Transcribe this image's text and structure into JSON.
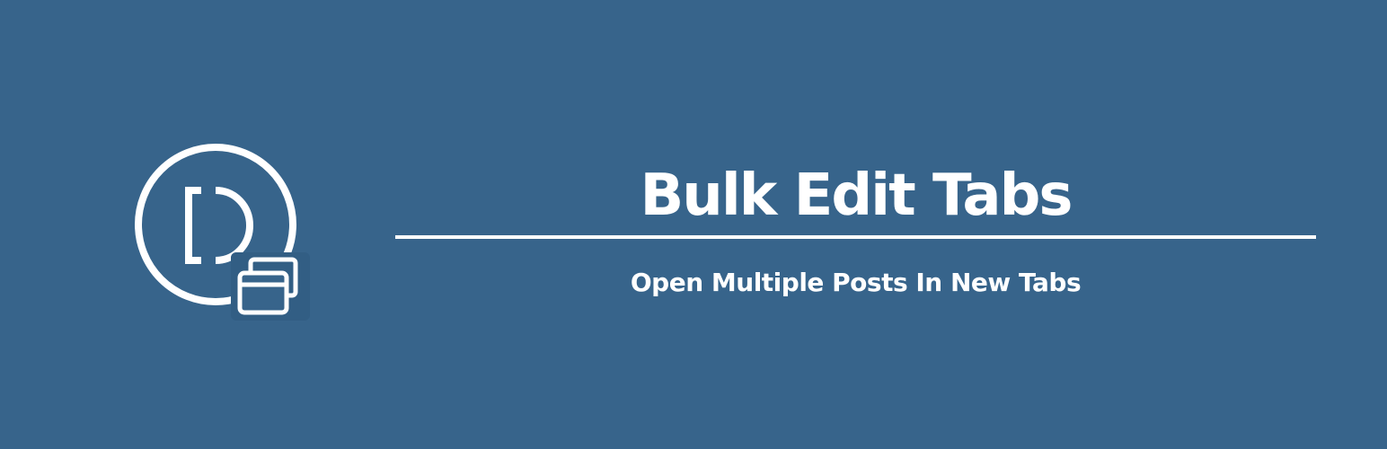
{
  "banner": {
    "title": "Bulk Edit Tabs",
    "subtitle": "Open Multiple Posts In New Tabs",
    "background_color": "#37648b",
    "text_color": "#ffffff",
    "logo_icon": "divi-tabs-logo-icon"
  }
}
